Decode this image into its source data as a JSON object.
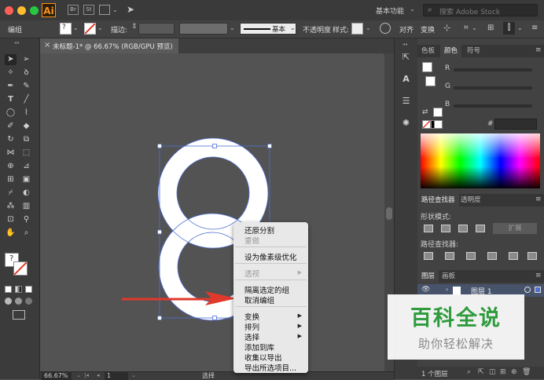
{
  "app": {
    "logo": "Ai",
    "bridge_label": "Br",
    "stock_label": "St",
    "workspace": "基本功能",
    "search_placeholder": "搜索 Adobe Stock"
  },
  "control_bar": {
    "group_label": "编组",
    "stroke_label": "描边:",
    "basic_label": "基本",
    "opacity_label": "不透明度",
    "style_label": "样式:",
    "align_label": "对齐",
    "transform_label": "变换"
  },
  "document": {
    "tab_title": "未标题-1* @ 66.67% (RGB/GPU 预览)",
    "close_glyph": "×"
  },
  "status_bar": {
    "zoom": "66.67%",
    "page": "1",
    "selection_tool": "选择"
  },
  "context_menu": {
    "items": [
      {
        "label": "还原分割",
        "enabled": true
      },
      {
        "label": "重做",
        "enabled": false
      },
      {
        "label": "设为像素级优化",
        "enabled": true
      },
      {
        "label": "透视",
        "enabled": false
      },
      {
        "label": "隔离选定的组",
        "enabled": true
      },
      {
        "label": "取消编组",
        "enabled": true
      },
      {
        "label": "变换",
        "enabled": true
      },
      {
        "label": "排列",
        "enabled": true
      },
      {
        "label": "选择",
        "enabled": true
      },
      {
        "label": "添加到库",
        "enabled": true
      },
      {
        "label": "收集以导出",
        "enabled": true
      },
      {
        "label": "导出所选项目...",
        "enabled": true
      }
    ]
  },
  "color_panel": {
    "tabs": [
      "色板",
      "颜色",
      "符号"
    ],
    "active_tab": "颜色",
    "channels": [
      "R",
      "G",
      "B"
    ],
    "hex_label": "#"
  },
  "pathfinder_panel": {
    "tabs": [
      "路径查找器",
      "透明度"
    ],
    "shape_modes_label": "形状模式:",
    "expand_label": "扩展",
    "pathfinders_label": "路径查找器:"
  },
  "layers_panel": {
    "tabs": [
      "图层",
      "画板"
    ],
    "layer_name": "图层 1",
    "count_label": "1 个图层"
  },
  "watermark": {
    "title": "百科全说",
    "subtitle": "助你轻松解决"
  },
  "colors": {
    "selection_blue": "#4f6fd1",
    "arrow_red": "#e0392b",
    "watermark_green": "#2e9c3c"
  }
}
